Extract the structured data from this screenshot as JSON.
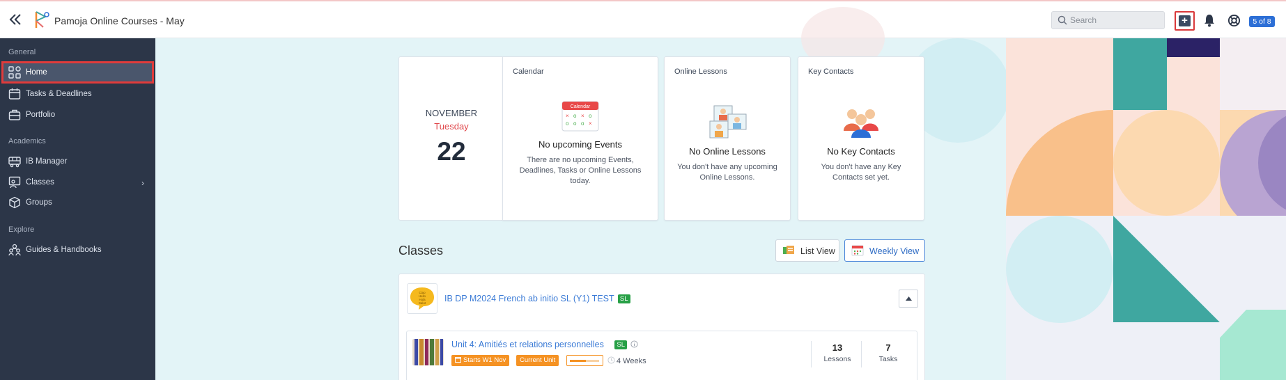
{
  "header": {
    "app_title": "Pamoja Online Courses - May",
    "search_placeholder": "Search",
    "notification_count": "5 of 8"
  },
  "sidebar": {
    "sections": [
      {
        "label": "General",
        "items": [
          {
            "label": "Home",
            "icon": "grid-icon",
            "active": true
          },
          {
            "label": "Tasks & Deadlines",
            "icon": "calendar-icon"
          },
          {
            "label": "Portfolio",
            "icon": "briefcase-icon"
          }
        ]
      },
      {
        "label": "Academics",
        "items": [
          {
            "label": "IB Manager",
            "icon": "bus-icon"
          },
          {
            "label": "Classes",
            "icon": "teacher-icon",
            "has_submenu": true
          },
          {
            "label": "Groups",
            "icon": "cube-icon"
          }
        ]
      },
      {
        "label": "Explore",
        "items": [
          {
            "label": "Guides & Handbooks",
            "icon": "people-icon"
          }
        ]
      }
    ]
  },
  "date_widget": {
    "month": "NOVEMBER",
    "weekday": "Tuesday",
    "day": "22"
  },
  "calendar_card": {
    "title": "Calendar",
    "icon_label": "Calendar",
    "empty_title": "No upcoming Events",
    "empty_text": "There are no upcoming Events, Deadlines, Tasks or Online Lessons today."
  },
  "online_lessons_card": {
    "title": "Online Lessons",
    "empty_title": "No Online Lessons",
    "empty_text": "You don't have any upcoming Online Lessons."
  },
  "key_contacts_card": {
    "title": "Key Contacts",
    "empty_title": "No Key Contacts",
    "empty_text": "You don't have any Key Contacts set yet."
  },
  "classes": {
    "heading": "Classes",
    "list_view_label": "List View",
    "weekly_view_label": "Weekly View",
    "items": [
      {
        "title": "IB DP M2024 French ab initio SL (Y1) TEST",
        "level": "SL",
        "avatar_text": "Ciao Hello Hola Salut",
        "unit": {
          "title": "Unit 4: Amitiés et relations personnelles",
          "level": "SL",
          "start_chip": "Starts W1 Nov",
          "status_chip": "Current Unit",
          "progress": 0.55,
          "duration": "4 Weeks",
          "lessons_count": "13",
          "lessons_label": "Lessons",
          "tasks_count": "7",
          "tasks_label": "Tasks"
        }
      }
    ]
  },
  "colors": {
    "accent": "#2d6fd6",
    "highlight": "#e03b3b",
    "sidebar": "#2c3648",
    "orange": "#f59223",
    "green": "#27a046"
  }
}
